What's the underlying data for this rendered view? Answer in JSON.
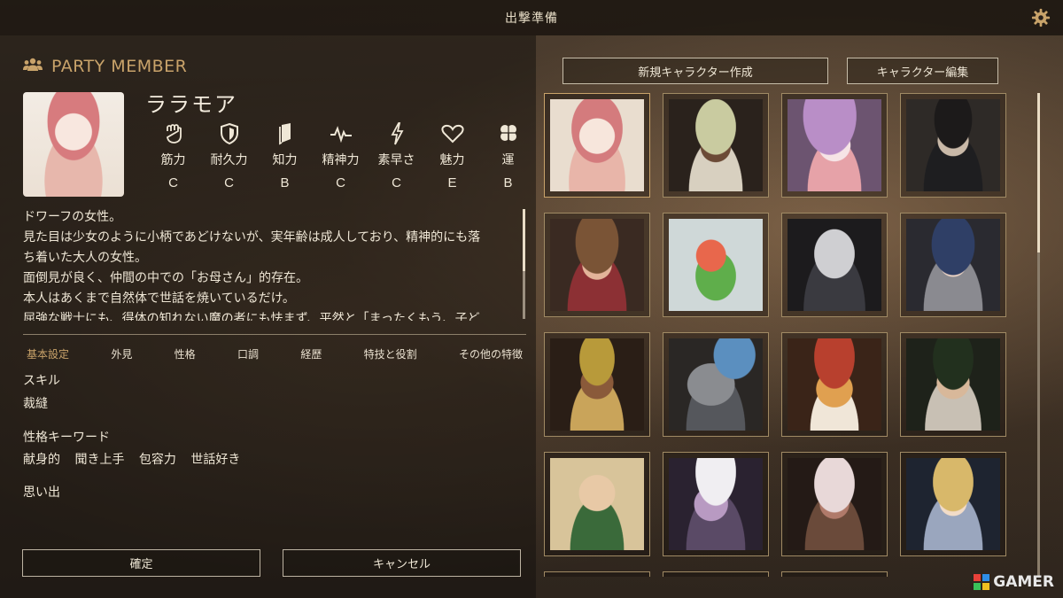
{
  "window": {
    "title": "出撃準備"
  },
  "party": {
    "header": "PARTY MEMBER",
    "name": "ララモア",
    "stats": [
      {
        "name": "筋力",
        "grade": "C",
        "icon": "fist-icon"
      },
      {
        "name": "耐久力",
        "grade": "C",
        "icon": "shield-icon"
      },
      {
        "name": "知力",
        "grade": "B",
        "icon": "book-icon"
      },
      {
        "name": "精神力",
        "grade": "C",
        "icon": "pulse-icon"
      },
      {
        "name": "素早さ",
        "grade": "C",
        "icon": "lightning-icon"
      },
      {
        "name": "魅力",
        "grade": "E",
        "icon": "heart-icon"
      },
      {
        "name": "運",
        "grade": "B",
        "icon": "clover-icon"
      }
    ],
    "description": [
      "ドワーフの女性。",
      "見た目は少女のように小柄であどけないが、実年齢は成人しており、精神的にも落",
      "ち着いた大人の女性。",
      "面倒見が良く、仲間の中での「お母さん」的存在。",
      "本人はあくまで自然体で世話を焼いているだけ。",
      "屈強な戦士にも、得体の知れない魔の者にも怯まず、平然と「まったくもう、子ど"
    ],
    "tabs": [
      "基本設定",
      "外見",
      "性格",
      "口調",
      "経歴",
      "特技と役割",
      "その他の特徴"
    ],
    "skill_label": "スキル",
    "skill_value": "裁縫",
    "keyword_label": "性格キーワード",
    "keywords": [
      "献身的",
      "聞き上手",
      "包容力",
      "世話好き"
    ],
    "memory_label": "思い出",
    "confirm_label": "確定",
    "cancel_label": "キャンセル"
  },
  "right": {
    "new_character_label": "新規キャラクター作成",
    "edit_character_label": "キャラクター編集"
  },
  "logo": {
    "text": "GAMER"
  },
  "colors": {
    "accent": "#c9a36a",
    "text": "#efe7d6",
    "border": "#a08a64"
  }
}
